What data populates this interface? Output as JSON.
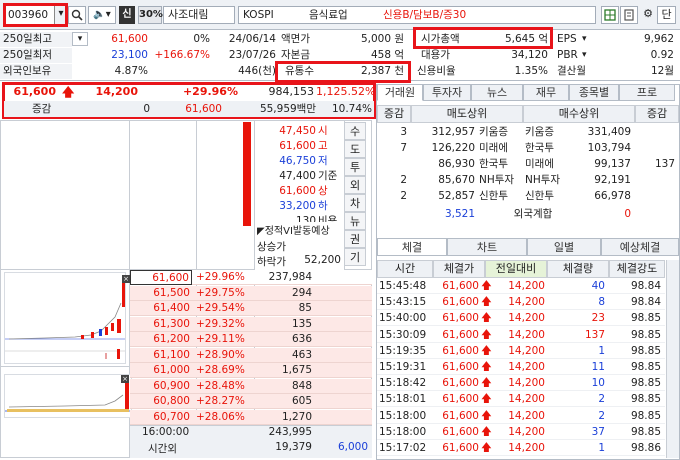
{
  "toolbar": {
    "code": "003960",
    "btn_sin": "신",
    "margin": "30%",
    "name": "사조대림",
    "market": "KOSPI",
    "sector": "음식료업",
    "flags": "신용B/담보B/증30",
    "btn_dan": "단"
  },
  "info": {
    "r1": {
      "l1": "250일최고",
      "v1": "61,600",
      "v1b": "0%",
      "v1c": "24/06/14",
      "l2": "액면가",
      "v2": "5,000 원",
      "l3": "시가총액",
      "v3": "5,645 억",
      "l4": "EPS",
      "v4": "9,962"
    },
    "r2": {
      "l1": "250일최저",
      "v1": "23,100",
      "v1b": "+166.67%",
      "v1c": "23/07/26",
      "l2": "자본금",
      "v2": "458 억",
      "l3": "대용가",
      "v3": "34,120",
      "l4": "PBR",
      "v4": "0.92"
    },
    "r3": {
      "l1": "외국인보유",
      "v1": "4.87%",
      "v1c": "446(천)",
      "l2": "유통수",
      "v2": "2,387 천",
      "l3": "신용비율",
      "v3": "1.35%",
      "l4": "결산월",
      "v4": "12월"
    }
  },
  "price": {
    "current": "61,600",
    "change": "14,200",
    "rate": "+29.96%",
    "volume": "984,153",
    "vol_rate": "1,125.52%",
    "sub_label": "증감",
    "sub_zero": "0",
    "sub_price": "61,600",
    "sub_amount": "55,959백만",
    "sub_rate": "10.74%"
  },
  "sell_side": [
    {
      "p": "47,450",
      "k": "시",
      "cls": "red"
    },
    {
      "p": "61,600",
      "k": "고",
      "cls": "red"
    },
    {
      "p": "46,750",
      "k": "저",
      "cls": "blue"
    },
    {
      "p": "47,400",
      "k": "기준",
      "cls": ""
    },
    {
      "p": "61,600",
      "k": "상",
      "cls": "red"
    },
    {
      "p": "33,200",
      "k": "하",
      "cls": "blue"
    },
    {
      "p": "130",
      "k": "비용",
      "cls": ""
    }
  ],
  "vi": {
    "title": "정적VI발동예상",
    "up": "상승가",
    "down": "하락가",
    "down_val": "52,200"
  },
  "side_buttons": [
    "수",
    "도",
    "투",
    "외",
    "차",
    "뉴",
    "권",
    "기"
  ],
  "orderbook": [
    {
      "price": "61,600",
      "rate": "+29.96%",
      "qty": "237,984"
    },
    {
      "price": "61,500",
      "rate": "+29.75%",
      "qty": "294"
    },
    {
      "price": "61,400",
      "rate": "+29.54%",
      "qty": "85"
    },
    {
      "price": "61,300",
      "rate": "+29.32%",
      "qty": "135"
    },
    {
      "price": "61,200",
      "rate": "+29.11%",
      "qty": "636"
    },
    {
      "price": "61,100",
      "rate": "+28.90%",
      "qty": "463"
    },
    {
      "price": "61,000",
      "rate": "+28.69%",
      "qty": "1,675"
    },
    {
      "price": "60,900",
      "rate": "+28.48%",
      "qty": "848"
    },
    {
      "price": "60,800",
      "rate": "+28.27%",
      "qty": "605"
    },
    {
      "price": "60,700",
      "rate": "+28.06%",
      "qty": "1,270"
    }
  ],
  "bottom": {
    "time": "16:00:00",
    "total": "243,995",
    "label": "시간외",
    "after": "19,379",
    "after2": "6,000"
  },
  "tabs": [
    "거래원",
    "투자자",
    "뉴스",
    "재무",
    "종목별",
    "프로"
  ],
  "broker_head": {
    "c1": "증감",
    "c2": "매도상위",
    "c3": "매수상위",
    "c4": "증감"
  },
  "brokers": [
    {
      "d1": "3",
      "sq": "312,957",
      "sn": "키움증",
      "bn": "키움증",
      "bq": "331,409",
      "d2": ""
    },
    {
      "d1": "7",
      "sq": "126,220",
      "sn": "미래에",
      "bn": "한국투",
      "bq": "103,794",
      "d2": ""
    },
    {
      "d1": "",
      "sq": "86,930",
      "sn": "한국투",
      "bn": "미래에",
      "bq": "99,137",
      "d2": "137"
    },
    {
      "d1": "2",
      "sq": "85,670",
      "sn": "NH투자",
      "bn": "NH투자",
      "bq": "92,191",
      "d2": ""
    },
    {
      "d1": "2",
      "sq": "52,857",
      "sn": "신한투",
      "bn": "신한투",
      "bq": "66,978",
      "d2": ""
    }
  ],
  "foreign": {
    "sq": "3,521",
    "label": "외국계합",
    "bq": "0"
  },
  "tabs2": [
    "체결",
    "차트",
    "일별",
    "예상체결"
  ],
  "trade_head": {
    "t": "시간",
    "p": "체결가",
    "c": "전일대비",
    "q": "체결량",
    "s": "체결강도"
  },
  "trades": [
    {
      "t": "15:45:48",
      "p": "61,600",
      "c": "14,200",
      "q": "40",
      "s": "98.84",
      "blue": true
    },
    {
      "t": "15:43:15",
      "p": "61,600",
      "c": "14,200",
      "q": "8",
      "s": "98.84",
      "blue": true
    },
    {
      "t": "15:40:00",
      "p": "61,600",
      "c": "14,200",
      "q": "23",
      "s": "98.85",
      "blue": false
    },
    {
      "t": "15:30:09",
      "p": "61,600",
      "c": "14,200",
      "q": "137",
      "s": "98.85",
      "blue": false
    },
    {
      "t": "15:19:35",
      "p": "61,600",
      "c": "14,200",
      "q": "1",
      "s": "98.85",
      "blue": true
    },
    {
      "t": "15:19:31",
      "p": "61,600",
      "c": "14,200",
      "q": "11",
      "s": "98.85",
      "blue": true
    },
    {
      "t": "15:18:42",
      "p": "61,600",
      "c": "14,200",
      "q": "10",
      "s": "98.85",
      "blue": true
    },
    {
      "t": "15:18:01",
      "p": "61,600",
      "c": "14,200",
      "q": "2",
      "s": "98.85",
      "blue": true
    },
    {
      "t": "15:18:00",
      "p": "61,600",
      "c": "14,200",
      "q": "2",
      "s": "98.85",
      "blue": true
    },
    {
      "t": "15:18:00",
      "p": "61,600",
      "c": "14,200",
      "q": "37",
      "s": "98.85",
      "blue": true
    },
    {
      "t": "15:17:02",
      "p": "61,600",
      "c": "14,200",
      "q": "1",
      "s": "98.86",
      "blue": true
    }
  ]
}
